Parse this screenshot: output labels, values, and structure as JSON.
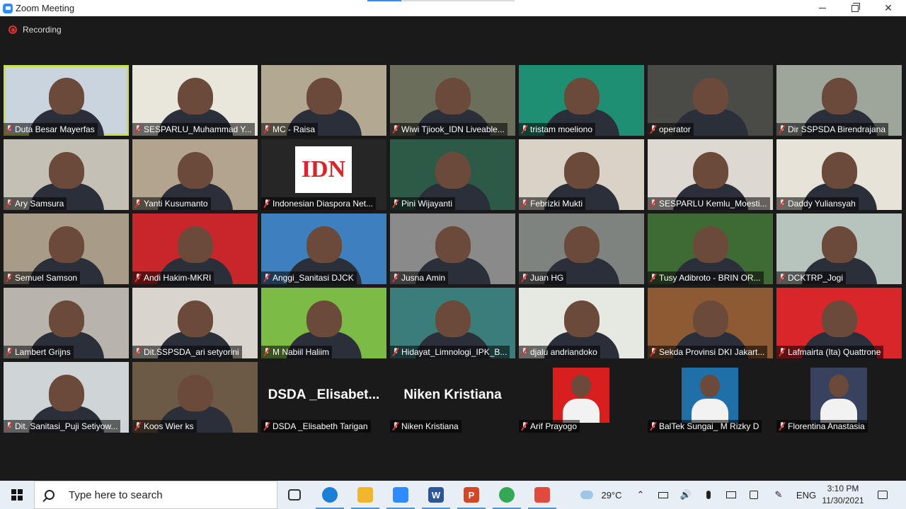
{
  "window": {
    "title": "Zoom Meeting",
    "minimize": "—",
    "close": "✕"
  },
  "meeting": {
    "recording_label": "Recording",
    "accent_color": "#2d8cff",
    "active_speaker_color": "#c8e04a"
  },
  "participants": [
    {
      "name": "Duta Besar Mayerfas",
      "bg": "#c9d4df",
      "active": true
    },
    {
      "name": "SESPARLU_Muhammad Y...",
      "bg": "#e9e6dc"
    },
    {
      "name": "MC - Raisa",
      "bg": "#b3a891"
    },
    {
      "name": "Wiwi Tjiook_IDN Liveable...",
      "bg": "#6a6e5a"
    },
    {
      "name": "tristam moeliono",
      "bg": "#1f8f73"
    },
    {
      "name": "operator",
      "bg": "#4a4a46"
    },
    {
      "name": "Dir SSPSDA Birendrajana",
      "bg": "#9ea69c"
    },
    {
      "name": "Ary Samsura",
      "bg": "#c4c0b5"
    },
    {
      "name": "Yanti Kusumanto",
      "bg": "#b3a48e"
    },
    {
      "name": "Indonesian Diaspora Net...",
      "bg": "#262626",
      "logo": "IDN"
    },
    {
      "name": "Pini Wijayanti",
      "bg": "#2c5a47"
    },
    {
      "name": "Febrizki Mukti",
      "bg": "#d9d2c6"
    },
    {
      "name": "SESPARLU Kemlu_Moesti...",
      "bg": "#ddd8d2"
    },
    {
      "name": "Daddy Yuliansyah",
      "bg": "#e7e3d8"
    },
    {
      "name": "Semuel Samson",
      "bg": "#a89c88"
    },
    {
      "name": "Andi Hakim-MKRI",
      "bg": "#c9262c"
    },
    {
      "name": "Anggi_Sanitasi DJCK",
      "bg": "#3e7fbf"
    },
    {
      "name": "Jusna Amin",
      "bg": "#8a8a8a"
    },
    {
      "name": "Juan HG",
      "bg": "#7f8380"
    },
    {
      "name": "Tusy Adibroto - BRIN OR...",
      "bg": "#3e6b33"
    },
    {
      "name": "DCKTRP_Jogi",
      "bg": "#b7c4bd"
    },
    {
      "name": "Lambert Grijns",
      "bg": "#b9b4ab"
    },
    {
      "name": "Dit.SSPSDA_ari setyorini",
      "bg": "#d9d5ce"
    },
    {
      "name": "M Nabiil Haliim",
      "bg": "#7dbb47"
    },
    {
      "name": "Hidayat_Limnologi_IPK_B...",
      "bg": "#3a7d7a"
    },
    {
      "name": "djalu andriandoko",
      "bg": "#e5e9e2"
    },
    {
      "name": "Sekda Provinsi DKI Jakart...",
      "bg": "#8e5a34"
    },
    {
      "name": "Lafmairta (Ita) Quattrone",
      "bg": "#d8262a"
    },
    {
      "name": "Dit. Sanitasi_Puji Setiyow...",
      "bg": "#cfd4d6"
    },
    {
      "name": "Koos Wier ks",
      "bg": "#6d5a45"
    },
    {
      "name": "DSDA _Elisabeth Tarigan",
      "bg": "#1a1a1a",
      "big_text": "DSDA  _Elisabet..."
    },
    {
      "name": "Niken Kristiana",
      "bg": "#1a1a1a",
      "big_text": "Niken Kristiana"
    },
    {
      "name": "Arif Prayogo",
      "bg": "#1a1a1a",
      "photo": "#d81e1e"
    },
    {
      "name": "BalTek Sungai_ M Rizky D",
      "bg": "#1a1a1a",
      "photo": "#1f6fa8"
    },
    {
      "name": "Florentina Anastasia",
      "bg": "#1a1a1a",
      "photo": "#38425e"
    }
  ],
  "taskbar": {
    "search_placeholder": "Type here to search",
    "weather": "29°C",
    "language": "ENG",
    "time": "3:10 PM",
    "date": "11/30/2021",
    "apps": [
      {
        "icon": "task-view-icon"
      },
      {
        "icon": "edge-icon",
        "color": "#1b7fd6"
      },
      {
        "icon": "file-explorer-icon",
        "color": "#f2b62e"
      },
      {
        "icon": "zoom-icon",
        "color": "#2d8cff"
      },
      {
        "icon": "word-icon",
        "color": "#2b579a",
        "letter": "W"
      },
      {
        "icon": "powerpoint-icon",
        "color": "#d24726",
        "letter": "P"
      },
      {
        "icon": "chrome-icon",
        "color": "#34a853"
      },
      {
        "icon": "snipping-icon",
        "color": "#e24a3d"
      }
    ]
  }
}
